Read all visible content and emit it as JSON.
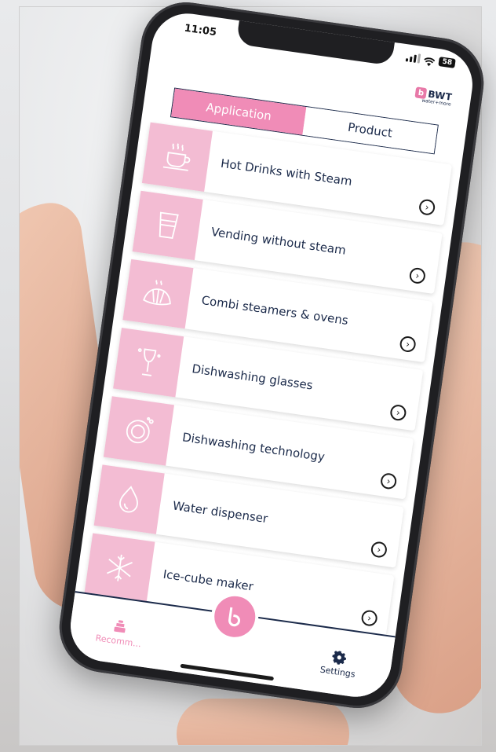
{
  "status": {
    "time": "11:05",
    "battery": "58"
  },
  "brand": {
    "name": "BWT",
    "tagline": "water+more",
    "mark": "b"
  },
  "tabs": {
    "application": "Application",
    "product": "Product"
  },
  "items": [
    {
      "label": "Hot Drinks with Steam",
      "icon": "coffee-cup-steam-icon"
    },
    {
      "label": "Vending without steam",
      "icon": "glass-icon"
    },
    {
      "label": "Combi steamers & ovens",
      "icon": "croissant-icon"
    },
    {
      "label": "Dishwashing glasses",
      "icon": "wine-glass-icon"
    },
    {
      "label": "Dishwashing technology",
      "icon": "plate-icon"
    },
    {
      "label": "Water dispenser",
      "icon": "water-drop-icon"
    },
    {
      "label": "Ice-cube maker",
      "icon": "snowflake-icon"
    }
  ],
  "tabbar": {
    "left": "Recomm...",
    "right": "Settings"
  },
  "colors": {
    "pink": "#f08cb7",
    "pink_light": "#f3bcd3",
    "navy": "#1b2a4a"
  }
}
